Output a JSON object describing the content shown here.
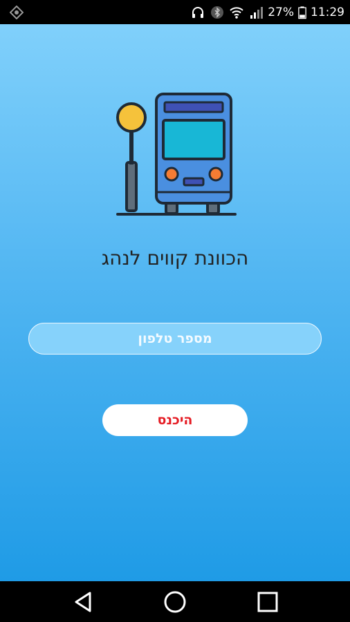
{
  "status_bar": {
    "battery_percent": "27%",
    "time": "11:29",
    "icons": [
      "location-icon",
      "headphones-icon",
      "bluetooth-icon",
      "wifi-icon",
      "signal-icon",
      "battery-icon"
    ]
  },
  "app": {
    "title": "הכוונת קווים לנהג",
    "phone_input": {
      "placeholder": "מספר טלפון",
      "value": ""
    },
    "login_button": {
      "label": "היכנס"
    },
    "illustration": "bus-stop-icon"
  },
  "colors": {
    "background_top": "#80d0fb",
    "background_bottom": "#1f9be6",
    "button_text": "#e51b23",
    "bus_body": "#4a8fe0",
    "bus_window": "#18b7d6",
    "stop_sign": "#f5c23b"
  },
  "nav_bar": {
    "buttons": [
      "back-icon",
      "home-icon",
      "recents-icon"
    ]
  }
}
